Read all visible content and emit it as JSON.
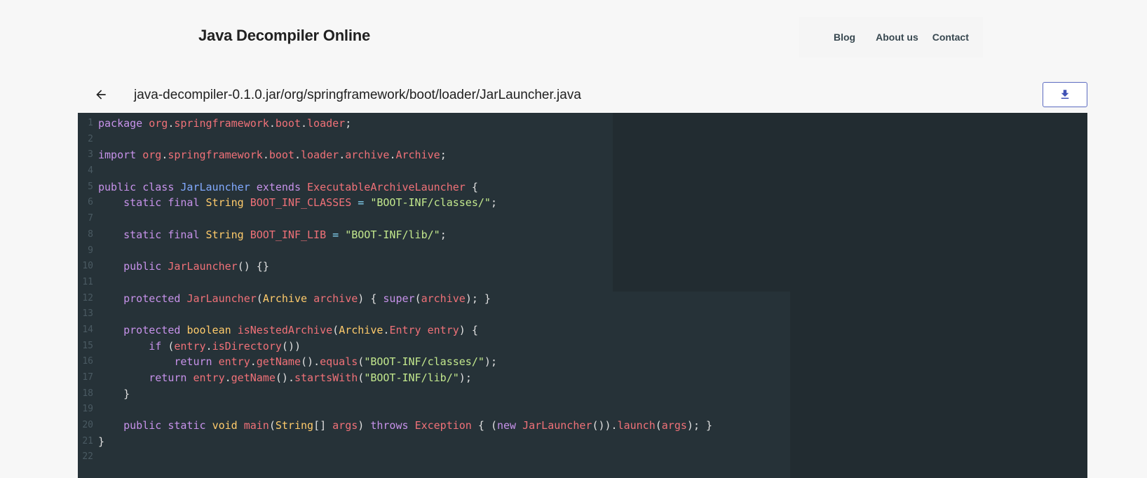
{
  "header": {
    "title": "Java Decompiler Online",
    "nav": [
      {
        "label": "Blog"
      },
      {
        "label": "About us"
      },
      {
        "label": "Contact"
      }
    ]
  },
  "toolbar": {
    "back_icon": "arrow-left-icon",
    "file_path": "java-decompiler-0.1.0.jar/org/springframework/boot/loader/JarLauncher.java",
    "download_icon": "download-icon"
  },
  "code": {
    "language": "java",
    "lines": [
      "package org.springframework.boot.loader;",
      "",
      "import org.springframework.boot.loader.archive.Archive;",
      "",
      "public class JarLauncher extends ExecutableArchiveLauncher {",
      "    static final String BOOT_INF_CLASSES = \"BOOT-INF/classes/\";",
      "",
      "    static final String BOOT_INF_LIB = \"BOOT-INF/lib/\";",
      "",
      "    public JarLauncher() {}",
      "",
      "    protected JarLauncher(Archive archive) { super(archive); }",
      "",
      "    protected boolean isNestedArchive(Archive.Entry entry) {",
      "        if (entry.isDirectory())",
      "            return entry.getName().equals(\"BOOT-INF/classes/\");",
      "        return entry.getName().startsWith(\"BOOT-INF/lib/\");",
      "    }",
      "",
      "    public static void main(String[] args) throws Exception { (new JarLauncher()).launch(args); }",
      "}",
      ""
    ]
  },
  "colors": {
    "code_background": "#263238",
    "keyword": "#c792ea",
    "identifier": "#f07178",
    "type": "#ffcb6b",
    "class_name": "#82aaff",
    "string": "#c3e88d",
    "operator": "#89ddff",
    "accent": "#3f51b5"
  }
}
